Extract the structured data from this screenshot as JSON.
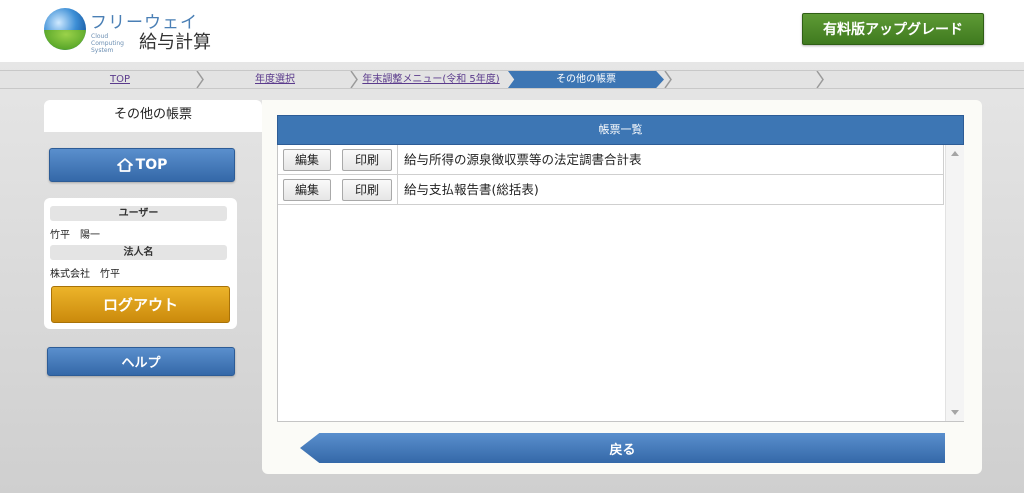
{
  "header": {
    "logo_text_top": "フリーウェイ",
    "logo_text_small": "Cloud Computing System",
    "logo_text_main": "給与計算",
    "upgrade_label": "有料版アップグレード"
  },
  "breadcrumb": {
    "items": [
      "TOP",
      "年度選択",
      "年末調整メニュー(令和 5年度)"
    ],
    "current": "その他の帳票"
  },
  "sidebar": {
    "tab_label": "その他の帳票",
    "top_label": "TOP",
    "user_label": "ユーザー",
    "user_value": "竹平　陽一",
    "corp_label": "法人名",
    "corp_value": "株式会社　竹平",
    "logout_label": "ログアウト",
    "help_label": "ヘルプ"
  },
  "main": {
    "list_title": "帳票一覧",
    "rows": [
      {
        "edit_label": "編集",
        "print_label": "印刷",
        "title": "給与所得の源泉徴収票等の法定調書合計表"
      },
      {
        "edit_label": "編集",
        "print_label": "印刷",
        "title": "給与支払報告書(総括表)"
      }
    ],
    "back_label": "戻る"
  },
  "colors": {
    "accent_blue": "#3d76b4",
    "upgrade_green": "#4a8a28",
    "logout_gold": "#dca01a"
  },
  "icons": {
    "top_button": "home-icon",
    "scroll_up": "arrow-up-icon",
    "scroll_down": "arrow-down-icon"
  }
}
